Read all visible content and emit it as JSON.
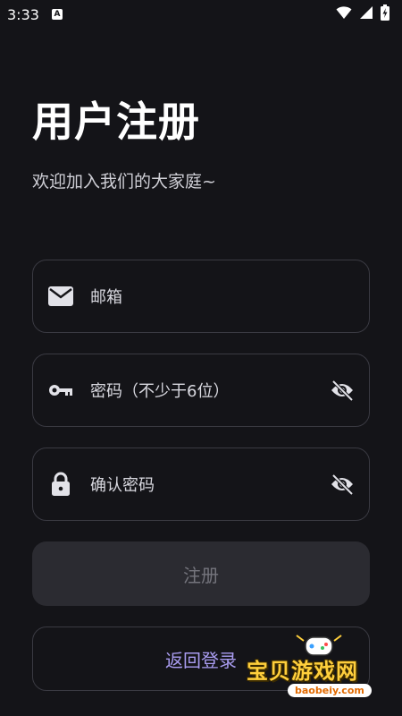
{
  "status_bar": {
    "time": "3:33",
    "a_label": "A"
  },
  "header": {
    "title": "用户注册",
    "subtitle": "欢迎加入我们的大家庭~"
  },
  "form": {
    "email": {
      "label": "邮箱",
      "icon": "mail-icon"
    },
    "password": {
      "label": "密码（不少于6位）",
      "icon": "key-icon",
      "toggle_icon": "eye-off-icon"
    },
    "confirm": {
      "label": "确认密码",
      "icon": "lock-icon",
      "toggle_icon": "eye-off-icon"
    }
  },
  "buttons": {
    "register": "注册",
    "back_to_login": "返回登录"
  },
  "watermark": {
    "text": "宝贝游戏网",
    "url": "baobeiy.com"
  },
  "colors": {
    "background": "#141418",
    "accent_text": "#a99cf0",
    "disabled_button_bg": "#2b2b31",
    "border": "#3a3a42"
  }
}
